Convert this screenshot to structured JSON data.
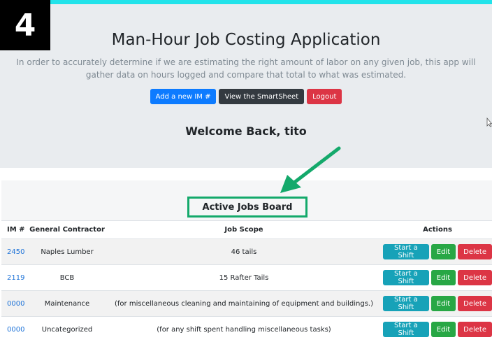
{
  "step_badge": "4",
  "header": {
    "title": "Man-Hour Job Costing Application",
    "subtitle": "In order to accurately determine if we are estimating the right amount of labor on any given job, this app will gather data on hours logged and compare that total to what was estimated.",
    "buttons": {
      "add": "Add a new IM #",
      "view": "View the SmartSheet",
      "logout": "Logout"
    },
    "welcome": "Welcome Back, tito"
  },
  "board": {
    "title": "Active Jobs Board",
    "columns": [
      "IM #",
      "General Contractor",
      "Job Scope",
      "Actions"
    ],
    "rows": [
      {
        "im": "2450",
        "contractor": "Naples Lumber",
        "scope": "46 tails"
      },
      {
        "im": "2119",
        "contractor": "BCB",
        "scope": "15 Rafter Tails"
      },
      {
        "im": "0000",
        "contractor": "Maintenance",
        "scope": "(for miscellaneous cleaning and maintaining of equipment and buildings.)"
      },
      {
        "im": "0000",
        "contractor": "Uncategorized",
        "scope": "(for any shift spent handling miscellaneous tasks)"
      }
    ],
    "actions": {
      "start": "Start a Shift",
      "edit": "Edit",
      "delete": "Delete"
    }
  },
  "colors": {
    "highlight": "#14a96b",
    "accent_bar": "#22e3ea"
  }
}
